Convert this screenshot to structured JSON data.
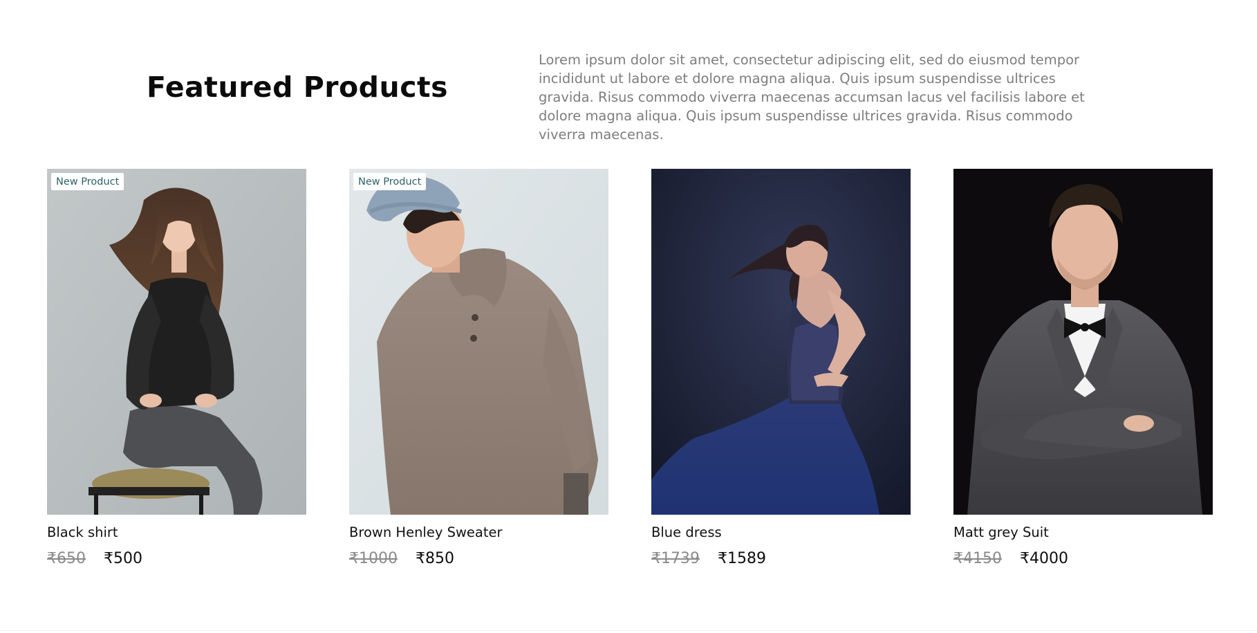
{
  "section": {
    "title": "Featured Products",
    "description": "Lorem ipsum dolor sit amet, consectetur adipiscing elit, sed do eiusmod tempor incididunt ut labore et dolore magna aliqua. Quis ipsum suspendisse ultrices gravida. Risus commodo viverra maecenas accumsan lacus vel facilisis labore et dolore magna aliqua. Quis ipsum suspendisse ultrices gravida. Risus commodo viverra maecenas."
  },
  "products": [
    {
      "name": "Black shirt",
      "badge": "New Product",
      "old_price": "₹650",
      "new_price": "₹500",
      "image": "woman-black-shirt-photo",
      "background": "#b8bdbe"
    },
    {
      "name": "Brown Henley Sweater",
      "badge": "New Product",
      "old_price": "₹1000",
      "new_price": "₹850",
      "image": "man-sweater-beanie-photo",
      "background": "#dde4e7"
    },
    {
      "name": "Blue dress",
      "badge": "",
      "old_price": "₹1739",
      "new_price": "₹1589",
      "image": "woman-blue-dress-photo",
      "background": "#1d2240"
    },
    {
      "name": "Matt grey Suit",
      "badge": "",
      "old_price": "₹4150",
      "new_price": "₹4000",
      "image": "man-grey-suit-photo",
      "background": "#0d0b0d"
    }
  ]
}
